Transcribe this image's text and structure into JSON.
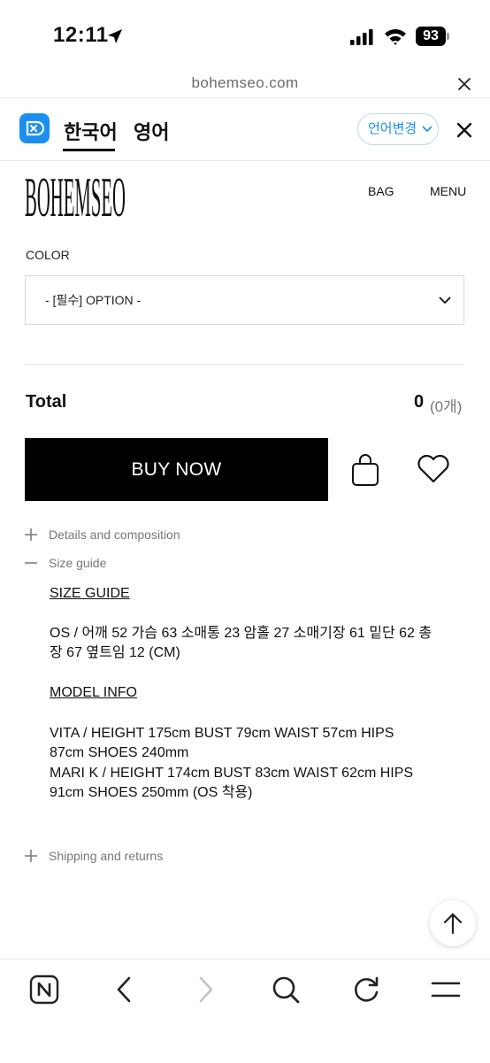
{
  "status_bar": {
    "time": "12:11",
    "battery": "93",
    "icons": [
      "location-arrow-icon",
      "cellular-signal-icon",
      "wifi-icon",
      "battery-icon"
    ]
  },
  "browser": {
    "url": "bohemseo.com",
    "icons": [
      "close-icon"
    ]
  },
  "translate_bar": {
    "tabs": [
      "한국어",
      "영어"
    ],
    "active_tab": "한국어",
    "change_language_label": "언어변경",
    "icons": [
      "translator-logo-icon",
      "chevron-down-icon",
      "close-icon"
    ],
    "accent_color": "#1c8ef0"
  },
  "site_header": {
    "brand": "BOHEMSEO",
    "nav": [
      "BAG",
      "MENU"
    ]
  },
  "product": {
    "color_label": "COLOR",
    "select_value": "- [필수] OPTION -",
    "total_label": "Total",
    "total_value": "0",
    "total_count": "(0개)",
    "buy_now_label": "BUY NOW",
    "icons": [
      "shopping-bag-icon",
      "heart-icon"
    ]
  },
  "accordions": [
    {
      "label": "Details and composition",
      "state": "collapsed"
    },
    {
      "label": "Size guide",
      "state": "expanded"
    },
    {
      "label": "Shipping and returns",
      "state": "collapsed"
    }
  ],
  "size_guide": {
    "size_heading": "SIZE GUIDE",
    "size_line1": "OS / 어깨 52 가슴 63 소매통 23 암홀 27 소매기장 61 밑단 62 총",
    "size_line2": "장 67 옆트임 12 (CM)",
    "model_heading": "MODEL INFO",
    "model_lines": [
      "VITA / HEIGHT 175cm BUST 79cm WAIST 57cm HIPS",
      "87cm SHOES 240mm",
      "MARI K / HEIGHT 174cm BUST 83cm WAIST 62cm HIPS",
      "91cm SHOES 250mm (OS 착용)"
    ]
  },
  "bottom_toolbar": {
    "icons": [
      "naver-home-icon",
      "back-arrow-icon",
      "forward-arrow-icon",
      "search-icon",
      "reload-icon",
      "menu-icon",
      "scroll-to-top-icon"
    ]
  }
}
